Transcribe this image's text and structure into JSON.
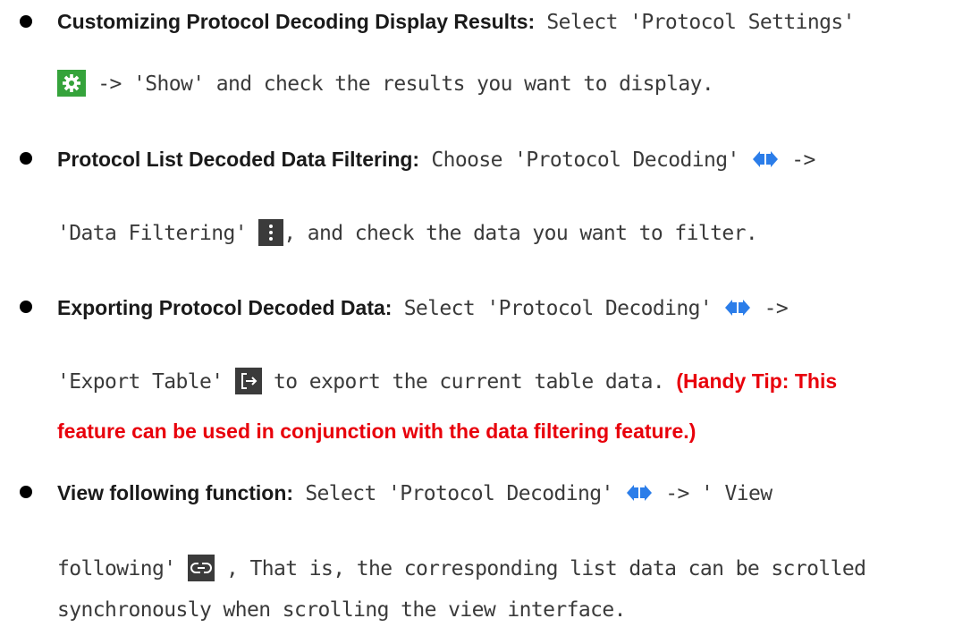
{
  "items": [
    {
      "title": "Customizing Protocol Decoding Display Results:",
      "t1": "Select 'Protocol Settings'",
      "t2": "-> 'Show' and check the results you want to display.",
      "icon": "settings-gear-icon"
    },
    {
      "title": "Protocol List Decoded Data Filtering:",
      "t1": "Choose 'Protocol Decoding'",
      "t2": "->",
      "t3": "'Data Filtering'",
      "t4": ", and check the data you want to filter.",
      "icons": [
        "protocol-decoding-icon",
        "more-vertical-icon"
      ]
    },
    {
      "title": "Exporting Protocol Decoded Data:",
      "t1": "Select 'Protocol Decoding'",
      "t2": "->",
      "t3": "'Export Table'",
      "t4": "to export the current table data.",
      "tip1": "(Handy Tip: This",
      "tip2": "feature can be used in conjunction with the data filtering feature.)",
      "icons": [
        "protocol-decoding-icon",
        "export-icon"
      ]
    },
    {
      "title": "View following function:",
      "t1": "Select 'Protocol Decoding'",
      "t2": "-> ' View",
      "t3": "following'",
      "t4": ", That is, the corresponding list data can be scrolled",
      "t5": "synchronously when scrolling the view interface.",
      "icons": [
        "protocol-decoding-icon",
        "link-follow-icon"
      ]
    }
  ],
  "colors": {
    "accent_red": "#e8000b",
    "gear_green": "#35a33b",
    "decode_blue": "#2b7de9",
    "dark_icon_bg": "#3b3b3b"
  }
}
